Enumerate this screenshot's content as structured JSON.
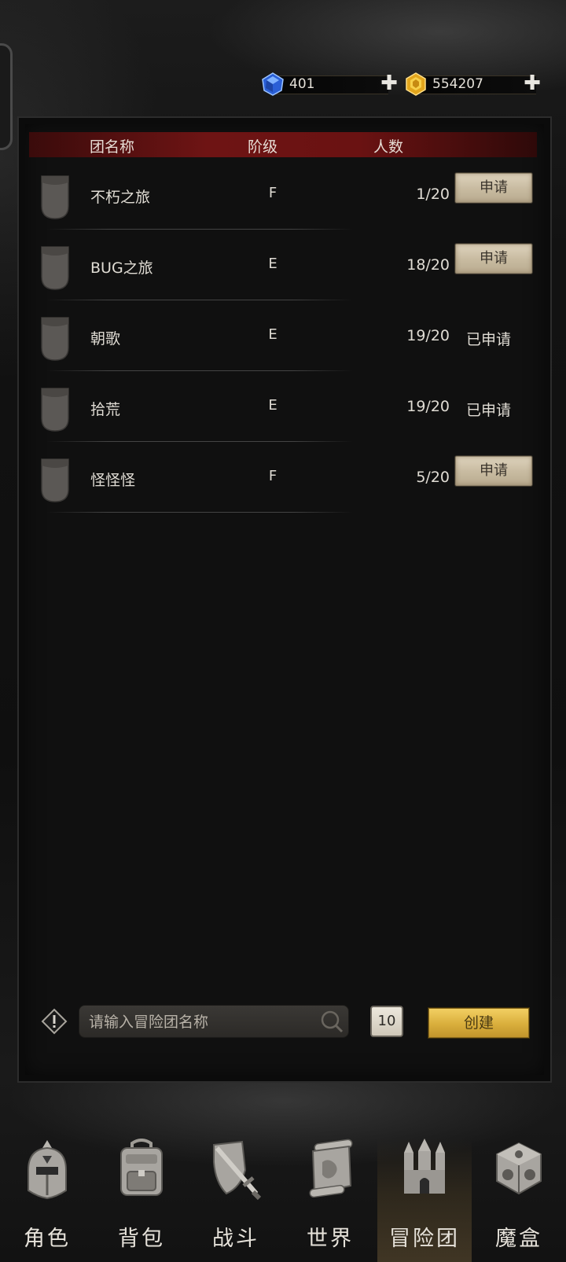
{
  "currency": {
    "gems": {
      "icon": "blue-gem-icon",
      "value": "401",
      "add_icon": "plus-icon"
    },
    "gold": {
      "icon": "gold-gem-icon",
      "value": "554207",
      "add_icon": "plus-icon"
    }
  },
  "table": {
    "headers": {
      "name": "团名称",
      "rank": "阶级",
      "members": "人数"
    },
    "rows": [
      {
        "name": "不朽之旅",
        "rank": "F",
        "members": "1/20",
        "action": "申请",
        "applied": false
      },
      {
        "name": "BUG之旅",
        "rank": "E",
        "members": "18/20",
        "action": "申请",
        "applied": false
      },
      {
        "name": "朝歌",
        "rank": "E",
        "members": "19/20",
        "action": "已申请",
        "applied": true
      },
      {
        "name": "拾荒",
        "rank": "E",
        "members": "19/20",
        "action": "已申请",
        "applied": true
      },
      {
        "name": "怪怪怪",
        "rank": "F",
        "members": "5/20",
        "action": "申请",
        "applied": false
      }
    ]
  },
  "create": {
    "placeholder": "请输入冒险团名称",
    "cost": "10",
    "button_label": "创建"
  },
  "nav": {
    "items": [
      {
        "label": "角色",
        "icon": "helmet-icon"
      },
      {
        "label": "背包",
        "icon": "backpack-icon"
      },
      {
        "label": "战斗",
        "icon": "shield-sword-icon"
      },
      {
        "label": "世界",
        "icon": "map-scroll-icon"
      },
      {
        "label": "冒险团",
        "icon": "castle-icon",
        "active": true
      },
      {
        "label": "魔盒",
        "icon": "magic-box-icon"
      }
    ]
  }
}
